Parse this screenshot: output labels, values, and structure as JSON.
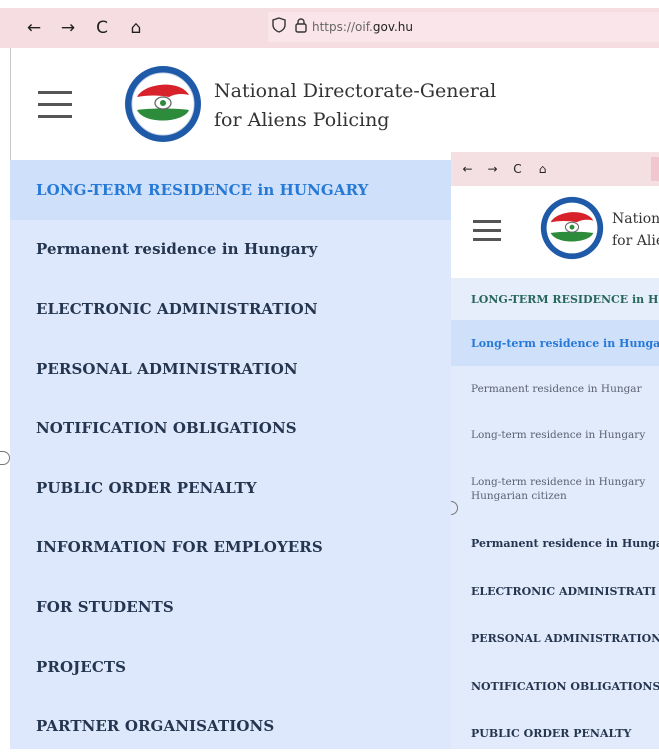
{
  "browser": {
    "nav": {
      "back": "←",
      "forward": "→",
      "reload": "C",
      "home": "⌂"
    },
    "url_prefix": "https://oif.",
    "url_domain": "gov.hu",
    "shield_icon": "shield-icon",
    "lock_icon": "lock-icon"
  },
  "site": {
    "title_line1": "National Directorate-General",
    "title_line2": "for Aliens Policing"
  },
  "menu": {
    "items": [
      {
        "label": "LONG-TERM RESIDENCE in HUNGARY",
        "active": true
      },
      {
        "label": "Permanent residence in Hungary"
      },
      {
        "label": "ELECTRONIC ADMINISTRATION"
      },
      {
        "label": "PERSONAL ADMINISTRATION"
      },
      {
        "label": "NOTIFICATION OBLIGATIONS"
      },
      {
        "label": "PUBLIC ORDER PENALTY"
      },
      {
        "label": "INFORMATION FOR EMPLOYERS"
      },
      {
        "label": "FOR STUDENTS"
      },
      {
        "label": "PROJECTS"
      },
      {
        "label": "PARTNER ORGANISATIONS"
      }
    ]
  },
  "inset": {
    "title_line1": "Nation",
    "title_line2": "for Alie",
    "menu": {
      "head": "LONG-TERM RESIDENCE in H",
      "active": "Long-term residence in Hungary",
      "sub1": "Permanent residence in Hungar",
      "sub2": "Long-term residence in Hungary",
      "sub3_line1": "Long-term residence in Hungary",
      "sub3_line2": "Hungarian citizen",
      "item1": "Permanent residence in Hungar",
      "item2": "ELECTRONIC ADMINISTRATI",
      "item3": "PERSONAL ADMINISTRATION",
      "item4": "NOTIFICATION OBLIGATIONS",
      "item5": "PUBLIC ORDER PENALTY"
    }
  },
  "colors": {
    "browser_bar": "#f6dde2",
    "menu_bg": "#dde8fc",
    "active_text": "#2779d6",
    "menu_text": "#25354f"
  }
}
